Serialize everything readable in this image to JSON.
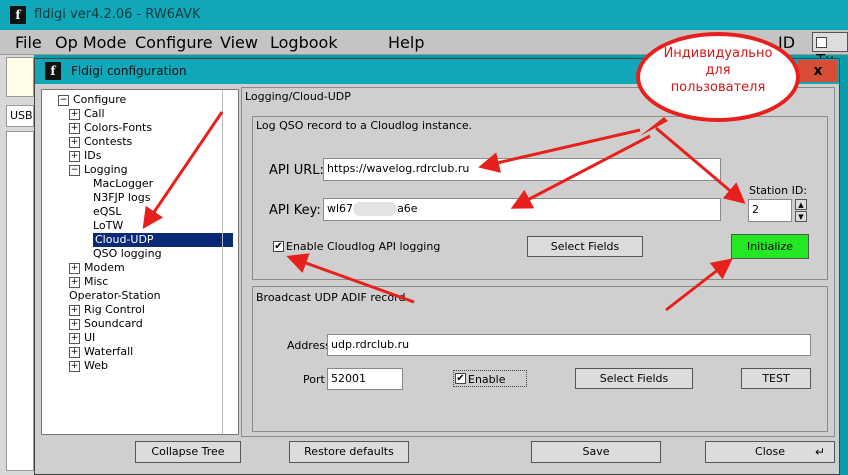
{
  "main_window": {
    "title": "fldigi ver4.2.06 - RW6AVK",
    "menu": [
      "File",
      "Op Mode",
      "Configure",
      "View",
      "Logbook",
      "Help"
    ],
    "right_partial": {
      "id_label": "ID",
      "tx_label": "Tx"
    },
    "left_partial_label": "USB"
  },
  "dialog": {
    "title": "Fldigi configuration",
    "close_label": "x",
    "tree": [
      {
        "label": "Configure",
        "level": 0,
        "expander": "−"
      },
      {
        "label": "Call",
        "level": 1,
        "expander": "+"
      },
      {
        "label": "Colors-Fonts",
        "level": 1,
        "expander": "+"
      },
      {
        "label": "Contests",
        "level": 1,
        "expander": "+"
      },
      {
        "label": "IDs",
        "level": 1,
        "expander": "+"
      },
      {
        "label": "Logging",
        "level": 1,
        "expander": "−"
      },
      {
        "label": "MacLogger",
        "level": 2,
        "expander": ""
      },
      {
        "label": "N3FJP logs",
        "level": 2,
        "expander": ""
      },
      {
        "label": "eQSL",
        "level": 2,
        "expander": ""
      },
      {
        "label": "LoTW",
        "level": 2,
        "expander": ""
      },
      {
        "label": "Cloud-UDP",
        "level": 2,
        "expander": "",
        "selected": true
      },
      {
        "label": "QSO logging",
        "level": 2,
        "expander": ""
      },
      {
        "label": "Modem",
        "level": 1,
        "expander": "+"
      },
      {
        "label": "Misc",
        "level": 1,
        "expander": "+"
      },
      {
        "label": "Operator-Station",
        "level": 1,
        "expander": ""
      },
      {
        "label": "Rig Control",
        "level": 1,
        "expander": "+"
      },
      {
        "label": "Soundcard",
        "level": 1,
        "expander": "+"
      },
      {
        "label": "UI",
        "level": 1,
        "expander": "+"
      },
      {
        "label": "Waterfall",
        "level": 1,
        "expander": "+"
      },
      {
        "label": "Web",
        "level": 1,
        "expander": "+"
      }
    ],
    "panel_title": "Logging/Cloud-UDP",
    "cloudlog": {
      "group_label": "Log QSO record to a Cloudlog instance.",
      "api_url_label": "API URL:",
      "api_url": "https://wavelog.rdrclub.ru",
      "api_key_label": "API Key:",
      "api_key_start": "wl67",
      "api_key_end": "a6e",
      "station_id_label": "Station ID:",
      "station_id": "2",
      "enable_label": "Enable Cloudlog API logging",
      "enable_checked": true,
      "select_fields": "Select Fields",
      "initialize": "Initialize"
    },
    "udp": {
      "group_label": "Broadcast UDP ADIF record",
      "address_label": "Address",
      "address": "udp.rdrclub.ru",
      "port_label": "Port",
      "port": "52001",
      "enable_label": "Enable",
      "enable_checked": true,
      "select_fields": "Select Fields",
      "test": "TEST"
    },
    "buttons": {
      "collapse_tree": "Collapse Tree",
      "restore_defaults": "Restore defaults",
      "save": "Save",
      "close": "Close"
    }
  },
  "annotation": {
    "callout_line1": "Индивидуально",
    "callout_line2": "для",
    "callout_line3": "пользователя"
  },
  "colors": {
    "titlebar": "#10a7b8",
    "initialize_button": "#25e825",
    "arrow": "#e8201c",
    "callout_bubble": "#e8201c",
    "selection": "#0a2a78"
  }
}
